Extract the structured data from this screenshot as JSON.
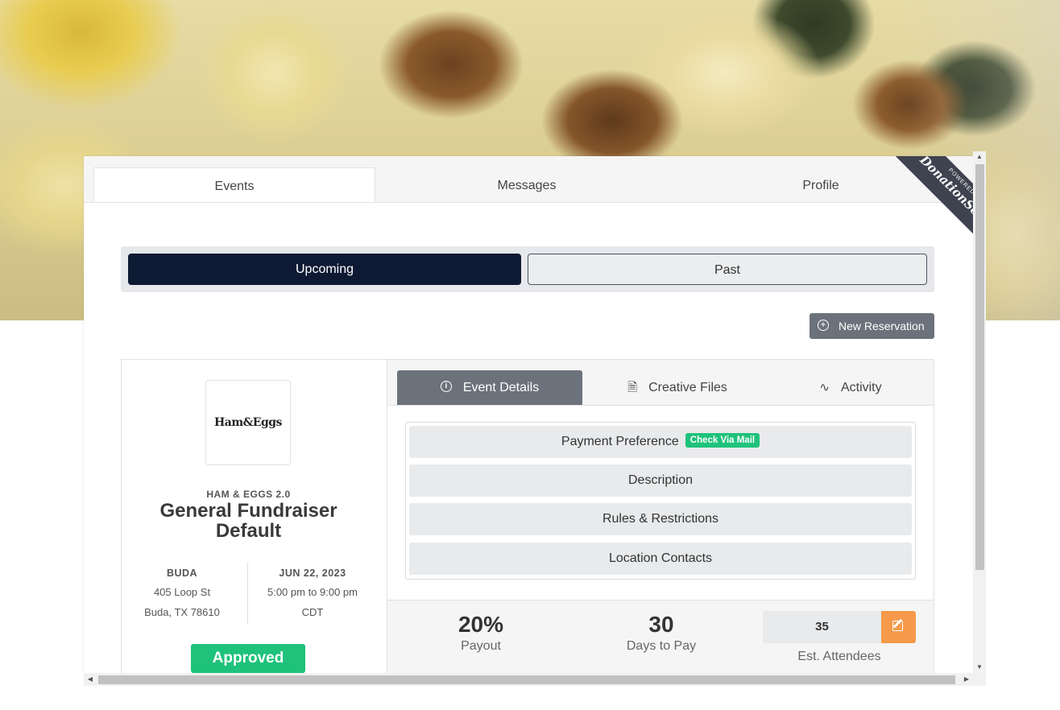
{
  "nav": {
    "tabs": [
      {
        "label": "Events"
      },
      {
        "label": "Messages"
      },
      {
        "label": "Profile"
      }
    ]
  },
  "ribbon": {
    "small": "POWERED BY",
    "brand": "DonationScout"
  },
  "toggle": {
    "upcoming": "Upcoming",
    "past": "Past"
  },
  "new_reservation": {
    "label": "New Reservation",
    "icon": "plus-circle-icon"
  },
  "event": {
    "logo_text": "Ham&Eggs",
    "org": "HAM & EGGS 2.0",
    "title": "General Fundraiser Default",
    "location": {
      "heading": "BUDA",
      "line1": "405 Loop St",
      "line2": "Buda, TX 78610"
    },
    "date": {
      "heading": "JUN 22, 2023",
      "line1": "5:00 pm to 9:00 pm",
      "line2": "CDT"
    },
    "status": "Approved"
  },
  "detail_tabs": [
    {
      "label": "Event Details",
      "icon": "info-icon"
    },
    {
      "label": "Creative Files",
      "icon": "file-icon"
    },
    {
      "label": "Activity",
      "icon": "activity-icon"
    }
  ],
  "accordion": {
    "payment_label": "Payment Preference",
    "payment_badge": "Check Via Mail",
    "description": "Description",
    "rules": "Rules & Restrictions",
    "contacts": "Location Contacts"
  },
  "stats": {
    "payout_value": "20%",
    "payout_label": "Payout",
    "days_value": "30",
    "days_label": "Days to Pay",
    "attendees_value": "35",
    "attendees_label": "Est. Attendees"
  },
  "colors": {
    "primary": "#0e1a33",
    "success": "#1ec27b",
    "edit": "#f59a4a",
    "gray_button": "#6c727b"
  }
}
